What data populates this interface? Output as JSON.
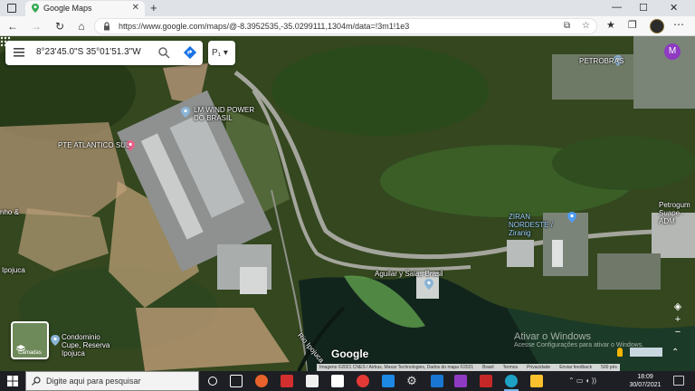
{
  "browser": {
    "tab_title": "Google Maps",
    "url": "https://www.google.com/maps/@-8.3952535,-35.0299111,1304m/data=!3m1!1e3"
  },
  "search": {
    "query": "8°23'45.0\"S 35°01'51.3\"W"
  },
  "map": {
    "layer_chip_text": "P₁",
    "avatar_letter": "M",
    "places": [
      {
        "name": "LM WIND POWER DO BRASIL",
        "style": "white"
      },
      {
        "name": "PETROBRAS",
        "style": "white"
      },
      {
        "name": "PTE ATLANTICO SUL",
        "style": "white"
      },
      {
        "name": "ZIRAN NORDESTE / Ziranig",
        "style": "blue"
      },
      {
        "name": "Petrogum Suape · ADM",
        "style": "white"
      },
      {
        "name": "Aguilar y Salas Brasil",
        "style": "white"
      },
      {
        "name": "Condominio Cupe, Reserva Ipojuca",
        "style": "white"
      },
      {
        "name": "Rio Ipojuca",
        "style": "white"
      },
      {
        "name": "nho &",
        "style": "white"
      },
      {
        "name": "Ipojuca",
        "style": "white"
      }
    ],
    "layers_label": "Camadas",
    "logo": "Google",
    "watermark_title": "Ativar o Windows",
    "watermark_sub": "Acesse Configurações para ativar o Windows.",
    "attribution": {
      "imagery": "Imagens ©2021 CNES / Airbus, Maxar Technologies, Dados do mapa ©2021",
      "country": "Brasil",
      "terms": "Termos",
      "privacy": "Privacidade",
      "feedback": "Enviar feedback",
      "scale": "500 pés"
    }
  },
  "taskbar": {
    "search_placeholder": "Digite aqui para pesquisar",
    "time": "18:09",
    "date": "30/07/2021"
  }
}
